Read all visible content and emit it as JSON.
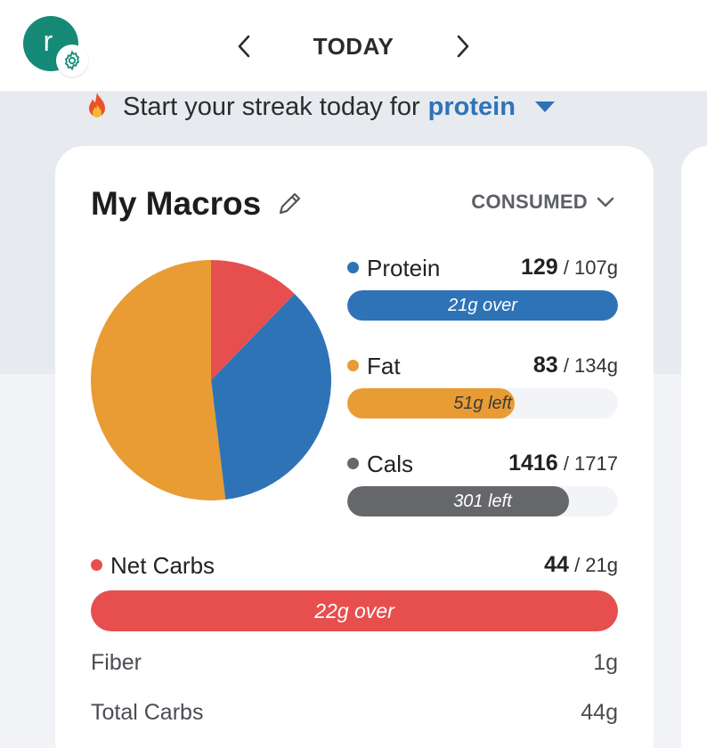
{
  "header": {
    "avatar_letter": "r",
    "title": "TODAY",
    "prev_icon": "chevron-left-icon",
    "next_icon": "chevron-right-icon"
  },
  "streak": {
    "text": "Start your streak today for",
    "macro": "protein",
    "icon": "flame-icon"
  },
  "card": {
    "title": "My Macros",
    "view_selector": "CONSUMED"
  },
  "macros": {
    "protein": {
      "label": "Protein",
      "consumed": "129",
      "target": " / 107g",
      "status": "21g over",
      "color": "#2f73b7",
      "progress": 1.0
    },
    "fat": {
      "label": "Fat",
      "consumed": "83",
      "target": " / 134g",
      "status": "51g left",
      "color": "#e99c33",
      "progress": 0.62
    },
    "cals": {
      "label": "Cals",
      "consumed": "1416",
      "target": " / 1717",
      "status": "301 left",
      "color": "#66676b",
      "progress": 0.82
    },
    "net_carbs": {
      "label": "Net Carbs",
      "consumed": "44",
      "target": " / 21g",
      "status": "22g over",
      "color": "#e74f4f",
      "progress": 1.0
    }
  },
  "details": {
    "fiber": {
      "label": "Fiber",
      "value": "1g"
    },
    "total_carbs": {
      "label": "Total Carbs",
      "value": "44g"
    }
  },
  "chart_data": {
    "type": "pie",
    "slices": [
      {
        "name": "Net Carbs",
        "value": 44,
        "color": "#e74f4f"
      },
      {
        "name": "Protein",
        "value": 129,
        "color": "#2f73b7"
      },
      {
        "name": "Fat",
        "value": 186.75,
        "color": "#e99c33"
      }
    ]
  }
}
